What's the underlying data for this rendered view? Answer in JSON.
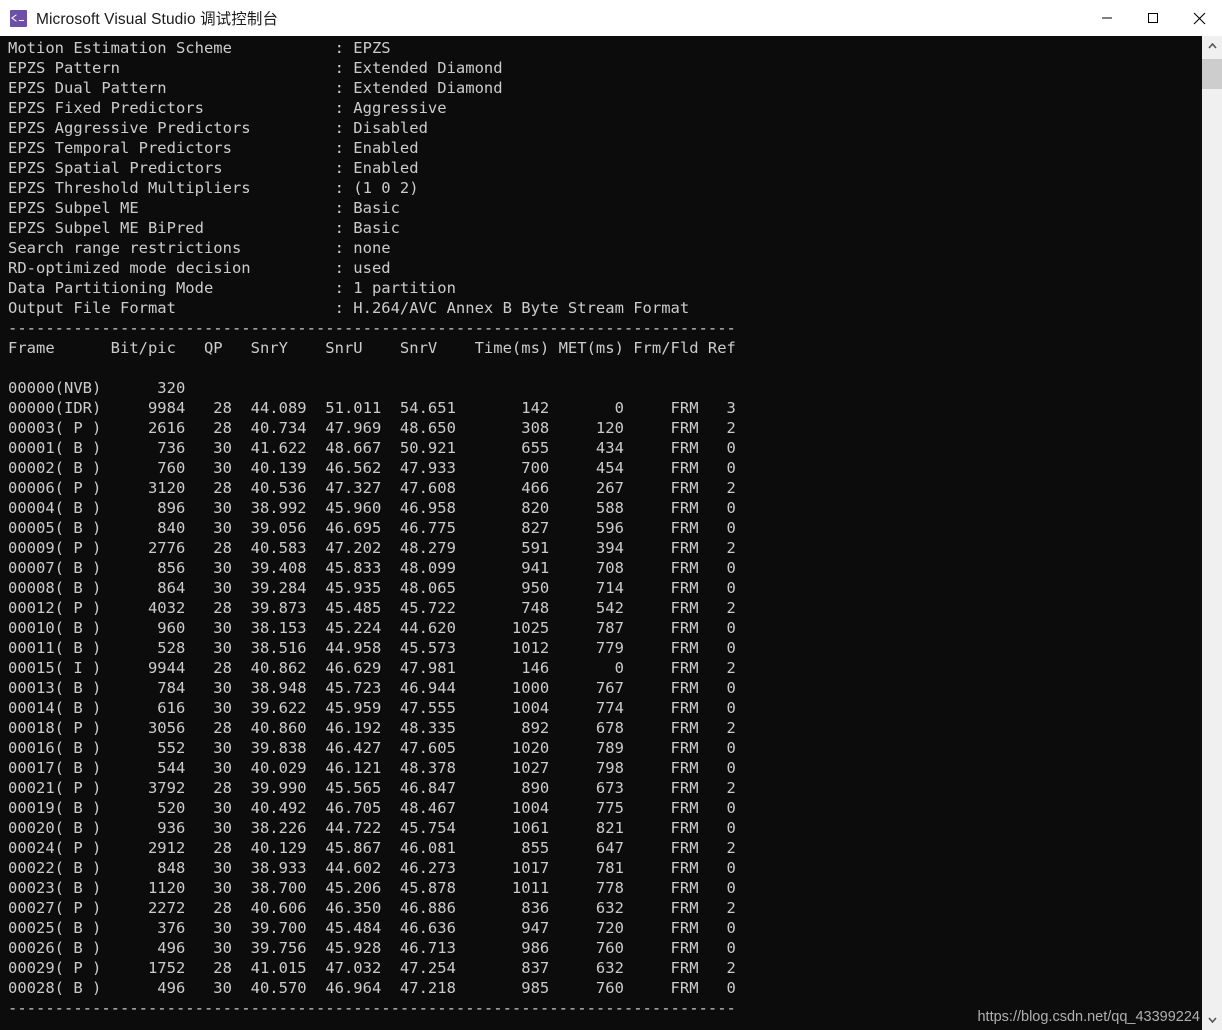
{
  "window": {
    "title": "Microsoft Visual Studio 调试控制台",
    "icon": "console-app-icon",
    "controls": {
      "minimize": "minimize-button",
      "maximize": "maximize-button",
      "close": "close-button"
    },
    "titlebar_bg": "#ffffff",
    "console_bg": "#0c0c0c",
    "console_fg": "#cccccc"
  },
  "scrollbar": {
    "up_arrow": "scroll-up-arrow",
    "down_arrow": "scroll-down-arrow",
    "thumb": "scroll-thumb",
    "track_color": "#f0f0f0",
    "thumb_color": "#cdcdcd"
  },
  "watermark": {
    "text": "https://blog.csdn.net/qq_43399224"
  },
  "console": {
    "settings": [
      {
        "key": "Motion Estimation Scheme",
        "value": "EPZS"
      },
      {
        "key": "EPZS Pattern",
        "value": "Extended Diamond"
      },
      {
        "key": "EPZS Dual Pattern",
        "value": "Extended Diamond"
      },
      {
        "key": "EPZS Fixed Predictors",
        "value": "Aggressive"
      },
      {
        "key": "EPZS Aggressive Predictors",
        "value": "Disabled"
      },
      {
        "key": "EPZS Temporal Predictors",
        "value": "Enabled"
      },
      {
        "key": "EPZS Spatial Predictors",
        "value": "Enabled"
      },
      {
        "key": "EPZS Threshold Multipliers",
        "value": "(1 0 2)"
      },
      {
        "key": "EPZS Subpel ME",
        "value": "Basic"
      },
      {
        "key": "EPZS Subpel ME BiPred",
        "value": "Basic"
      },
      {
        "key": "Search range restrictions",
        "value": "none"
      },
      {
        "key": "RD-optimized mode decision",
        "value": "used"
      },
      {
        "key": "Data Partitioning Mode",
        "value": "1 partition"
      },
      {
        "key": "Output File Format",
        "value": "H.264/AVC Annex B Byte Stream Format"
      }
    ],
    "separator": "------------------------------------------------------------------------------",
    "table": {
      "headers": [
        "Frame",
        "Bit/pic",
        "QP",
        "SnrY",
        "SnrU",
        "SnrV",
        "Time(ms)",
        "MET(ms)",
        "Frm/Fld",
        "Ref"
      ],
      "header_line": "Frame      Bit/pic   QP   SnrY    SnrU    SnrV    Time(ms) MET(ms) Frm/Fld Ref",
      "rows": [
        {
          "frame": "00000(NVB)",
          "bit": "320",
          "qp": "",
          "snry": "",
          "snru": "",
          "snrv": "",
          "time": "",
          "met": "",
          "frmfld": "",
          "ref": ""
        },
        {
          "frame": "00000(IDR)",
          "bit": "9984",
          "qp": "28",
          "snry": "44.089",
          "snru": "51.011",
          "snrv": "54.651",
          "time": "142",
          "met": "0",
          "frmfld": "FRM",
          "ref": "3"
        },
        {
          "frame": "00003( P )",
          "bit": "2616",
          "qp": "28",
          "snry": "40.734",
          "snru": "47.969",
          "snrv": "48.650",
          "time": "308",
          "met": "120",
          "frmfld": "FRM",
          "ref": "2"
        },
        {
          "frame": "00001( B )",
          "bit": "736",
          "qp": "30",
          "snry": "41.622",
          "snru": "48.667",
          "snrv": "50.921",
          "time": "655",
          "met": "434",
          "frmfld": "FRM",
          "ref": "0"
        },
        {
          "frame": "00002( B )",
          "bit": "760",
          "qp": "30",
          "snry": "40.139",
          "snru": "46.562",
          "snrv": "47.933",
          "time": "700",
          "met": "454",
          "frmfld": "FRM",
          "ref": "0"
        },
        {
          "frame": "00006( P )",
          "bit": "3120",
          "qp": "28",
          "snry": "40.536",
          "snru": "47.327",
          "snrv": "47.608",
          "time": "466",
          "met": "267",
          "frmfld": "FRM",
          "ref": "2"
        },
        {
          "frame": "00004( B )",
          "bit": "896",
          "qp": "30",
          "snry": "38.992",
          "snru": "45.960",
          "snrv": "46.958",
          "time": "820",
          "met": "588",
          "frmfld": "FRM",
          "ref": "0"
        },
        {
          "frame": "00005( B )",
          "bit": "840",
          "qp": "30",
          "snry": "39.056",
          "snru": "46.695",
          "snrv": "46.775",
          "time": "827",
          "met": "596",
          "frmfld": "FRM",
          "ref": "0"
        },
        {
          "frame": "00009( P )",
          "bit": "2776",
          "qp": "28",
          "snry": "40.583",
          "snru": "47.202",
          "snrv": "48.279",
          "time": "591",
          "met": "394",
          "frmfld": "FRM",
          "ref": "2"
        },
        {
          "frame": "00007( B )",
          "bit": "856",
          "qp": "30",
          "snry": "39.408",
          "snru": "45.833",
          "snrv": "48.099",
          "time": "941",
          "met": "708",
          "frmfld": "FRM",
          "ref": "0"
        },
        {
          "frame": "00008( B )",
          "bit": "864",
          "qp": "30",
          "snry": "39.284",
          "snru": "45.935",
          "snrv": "48.065",
          "time": "950",
          "met": "714",
          "frmfld": "FRM",
          "ref": "0"
        },
        {
          "frame": "00012( P )",
          "bit": "4032",
          "qp": "28",
          "snry": "39.873",
          "snru": "45.485",
          "snrv": "45.722",
          "time": "748",
          "met": "542",
          "frmfld": "FRM",
          "ref": "2"
        },
        {
          "frame": "00010( B )",
          "bit": "960",
          "qp": "30",
          "snry": "38.153",
          "snru": "45.224",
          "snrv": "44.620",
          "time": "1025",
          "met": "787",
          "frmfld": "FRM",
          "ref": "0"
        },
        {
          "frame": "00011( B )",
          "bit": "528",
          "qp": "30",
          "snry": "38.516",
          "snru": "44.958",
          "snrv": "45.573",
          "time": "1012",
          "met": "779",
          "frmfld": "FRM",
          "ref": "0"
        },
        {
          "frame": "00015( I )",
          "bit": "9944",
          "qp": "28",
          "snry": "40.862",
          "snru": "46.629",
          "snrv": "47.981",
          "time": "146",
          "met": "0",
          "frmfld": "FRM",
          "ref": "2"
        },
        {
          "frame": "00013( B )",
          "bit": "784",
          "qp": "30",
          "snry": "38.948",
          "snru": "45.723",
          "snrv": "46.944",
          "time": "1000",
          "met": "767",
          "frmfld": "FRM",
          "ref": "0"
        },
        {
          "frame": "00014( B )",
          "bit": "616",
          "qp": "30",
          "snry": "39.622",
          "snru": "45.959",
          "snrv": "47.555",
          "time": "1004",
          "met": "774",
          "frmfld": "FRM",
          "ref": "0"
        },
        {
          "frame": "00018( P )",
          "bit": "3056",
          "qp": "28",
          "snry": "40.860",
          "snru": "46.192",
          "snrv": "48.335",
          "time": "892",
          "met": "678",
          "frmfld": "FRM",
          "ref": "2"
        },
        {
          "frame": "00016( B )",
          "bit": "552",
          "qp": "30",
          "snry": "39.838",
          "snru": "46.427",
          "snrv": "47.605",
          "time": "1020",
          "met": "789",
          "frmfld": "FRM",
          "ref": "0"
        },
        {
          "frame": "00017( B )",
          "bit": "544",
          "qp": "30",
          "snry": "40.029",
          "snru": "46.121",
          "snrv": "48.378",
          "time": "1027",
          "met": "798",
          "frmfld": "FRM",
          "ref": "0"
        },
        {
          "frame": "00021( P )",
          "bit": "3792",
          "qp": "28",
          "snry": "39.990",
          "snru": "45.565",
          "snrv": "46.847",
          "time": "890",
          "met": "673",
          "frmfld": "FRM",
          "ref": "2"
        },
        {
          "frame": "00019( B )",
          "bit": "520",
          "qp": "30",
          "snry": "40.492",
          "snru": "46.705",
          "snrv": "48.467",
          "time": "1004",
          "met": "775",
          "frmfld": "FRM",
          "ref": "0"
        },
        {
          "frame": "00020( B )",
          "bit": "936",
          "qp": "30",
          "snry": "38.226",
          "snru": "44.722",
          "snrv": "45.754",
          "time": "1061",
          "met": "821",
          "frmfld": "FRM",
          "ref": "0"
        },
        {
          "frame": "00024( P )",
          "bit": "2912",
          "qp": "28",
          "snry": "40.129",
          "snru": "45.867",
          "snrv": "46.081",
          "time": "855",
          "met": "647",
          "frmfld": "FRM",
          "ref": "2"
        },
        {
          "frame": "00022( B )",
          "bit": "848",
          "qp": "30",
          "snry": "38.933",
          "snru": "44.602",
          "snrv": "46.273",
          "time": "1017",
          "met": "781",
          "frmfld": "FRM",
          "ref": "0"
        },
        {
          "frame": "00023( B )",
          "bit": "1120",
          "qp": "30",
          "snry": "38.700",
          "snru": "45.206",
          "snrv": "45.878",
          "time": "1011",
          "met": "778",
          "frmfld": "FRM",
          "ref": "0"
        },
        {
          "frame": "00027( P )",
          "bit": "2272",
          "qp": "28",
          "snry": "40.606",
          "snru": "46.350",
          "snrv": "46.886",
          "time": "836",
          "met": "632",
          "frmfld": "FRM",
          "ref": "2"
        },
        {
          "frame": "00025( B )",
          "bit": "376",
          "qp": "30",
          "snry": "39.700",
          "snru": "45.484",
          "snrv": "46.636",
          "time": "947",
          "met": "720",
          "frmfld": "FRM",
          "ref": "0"
        },
        {
          "frame": "00026( B )",
          "bit": "496",
          "qp": "30",
          "snry": "39.756",
          "snru": "45.928",
          "snrv": "46.713",
          "time": "986",
          "met": "760",
          "frmfld": "FRM",
          "ref": "0"
        },
        {
          "frame": "00029( P )",
          "bit": "1752",
          "qp": "28",
          "snry": "41.015",
          "snru": "47.032",
          "snrv": "47.254",
          "time": "837",
          "met": "632",
          "frmfld": "FRM",
          "ref": "2"
        },
        {
          "frame": "00028( B )",
          "bit": "496",
          "qp": "30",
          "snry": "40.570",
          "snru": "46.964",
          "snrv": "47.218",
          "time": "985",
          "met": "760",
          "frmfld": "FRM",
          "ref": "0"
        }
      ]
    }
  }
}
